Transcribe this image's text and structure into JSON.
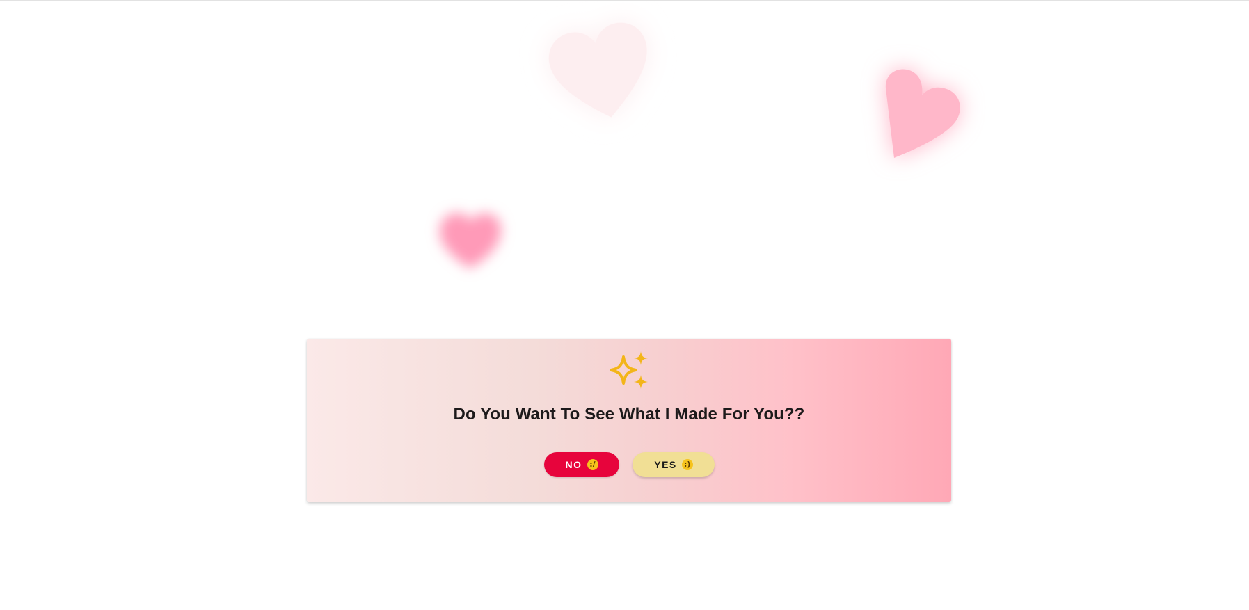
{
  "dialog": {
    "icon": "sparkles-icon",
    "question": "Do You Want To See What I Made For You??",
    "no_button": {
      "label": "NO",
      "emoji": ":/"
    },
    "yes_button": {
      "label": "YES",
      "emoji": ";)"
    }
  },
  "decorations": {
    "hearts": [
      "heart-icon",
      "heart-icon",
      "heart-icon"
    ]
  },
  "colors": {
    "no_button": "#e7043c",
    "yes_button": "#f1df95",
    "sparkle": "#f3b519",
    "heart_light": "#fdeef0",
    "heart_pink": "#ffb6c8",
    "card_gradient_start": "#fbe9e8",
    "card_gradient_end": "#ffa8b6"
  }
}
